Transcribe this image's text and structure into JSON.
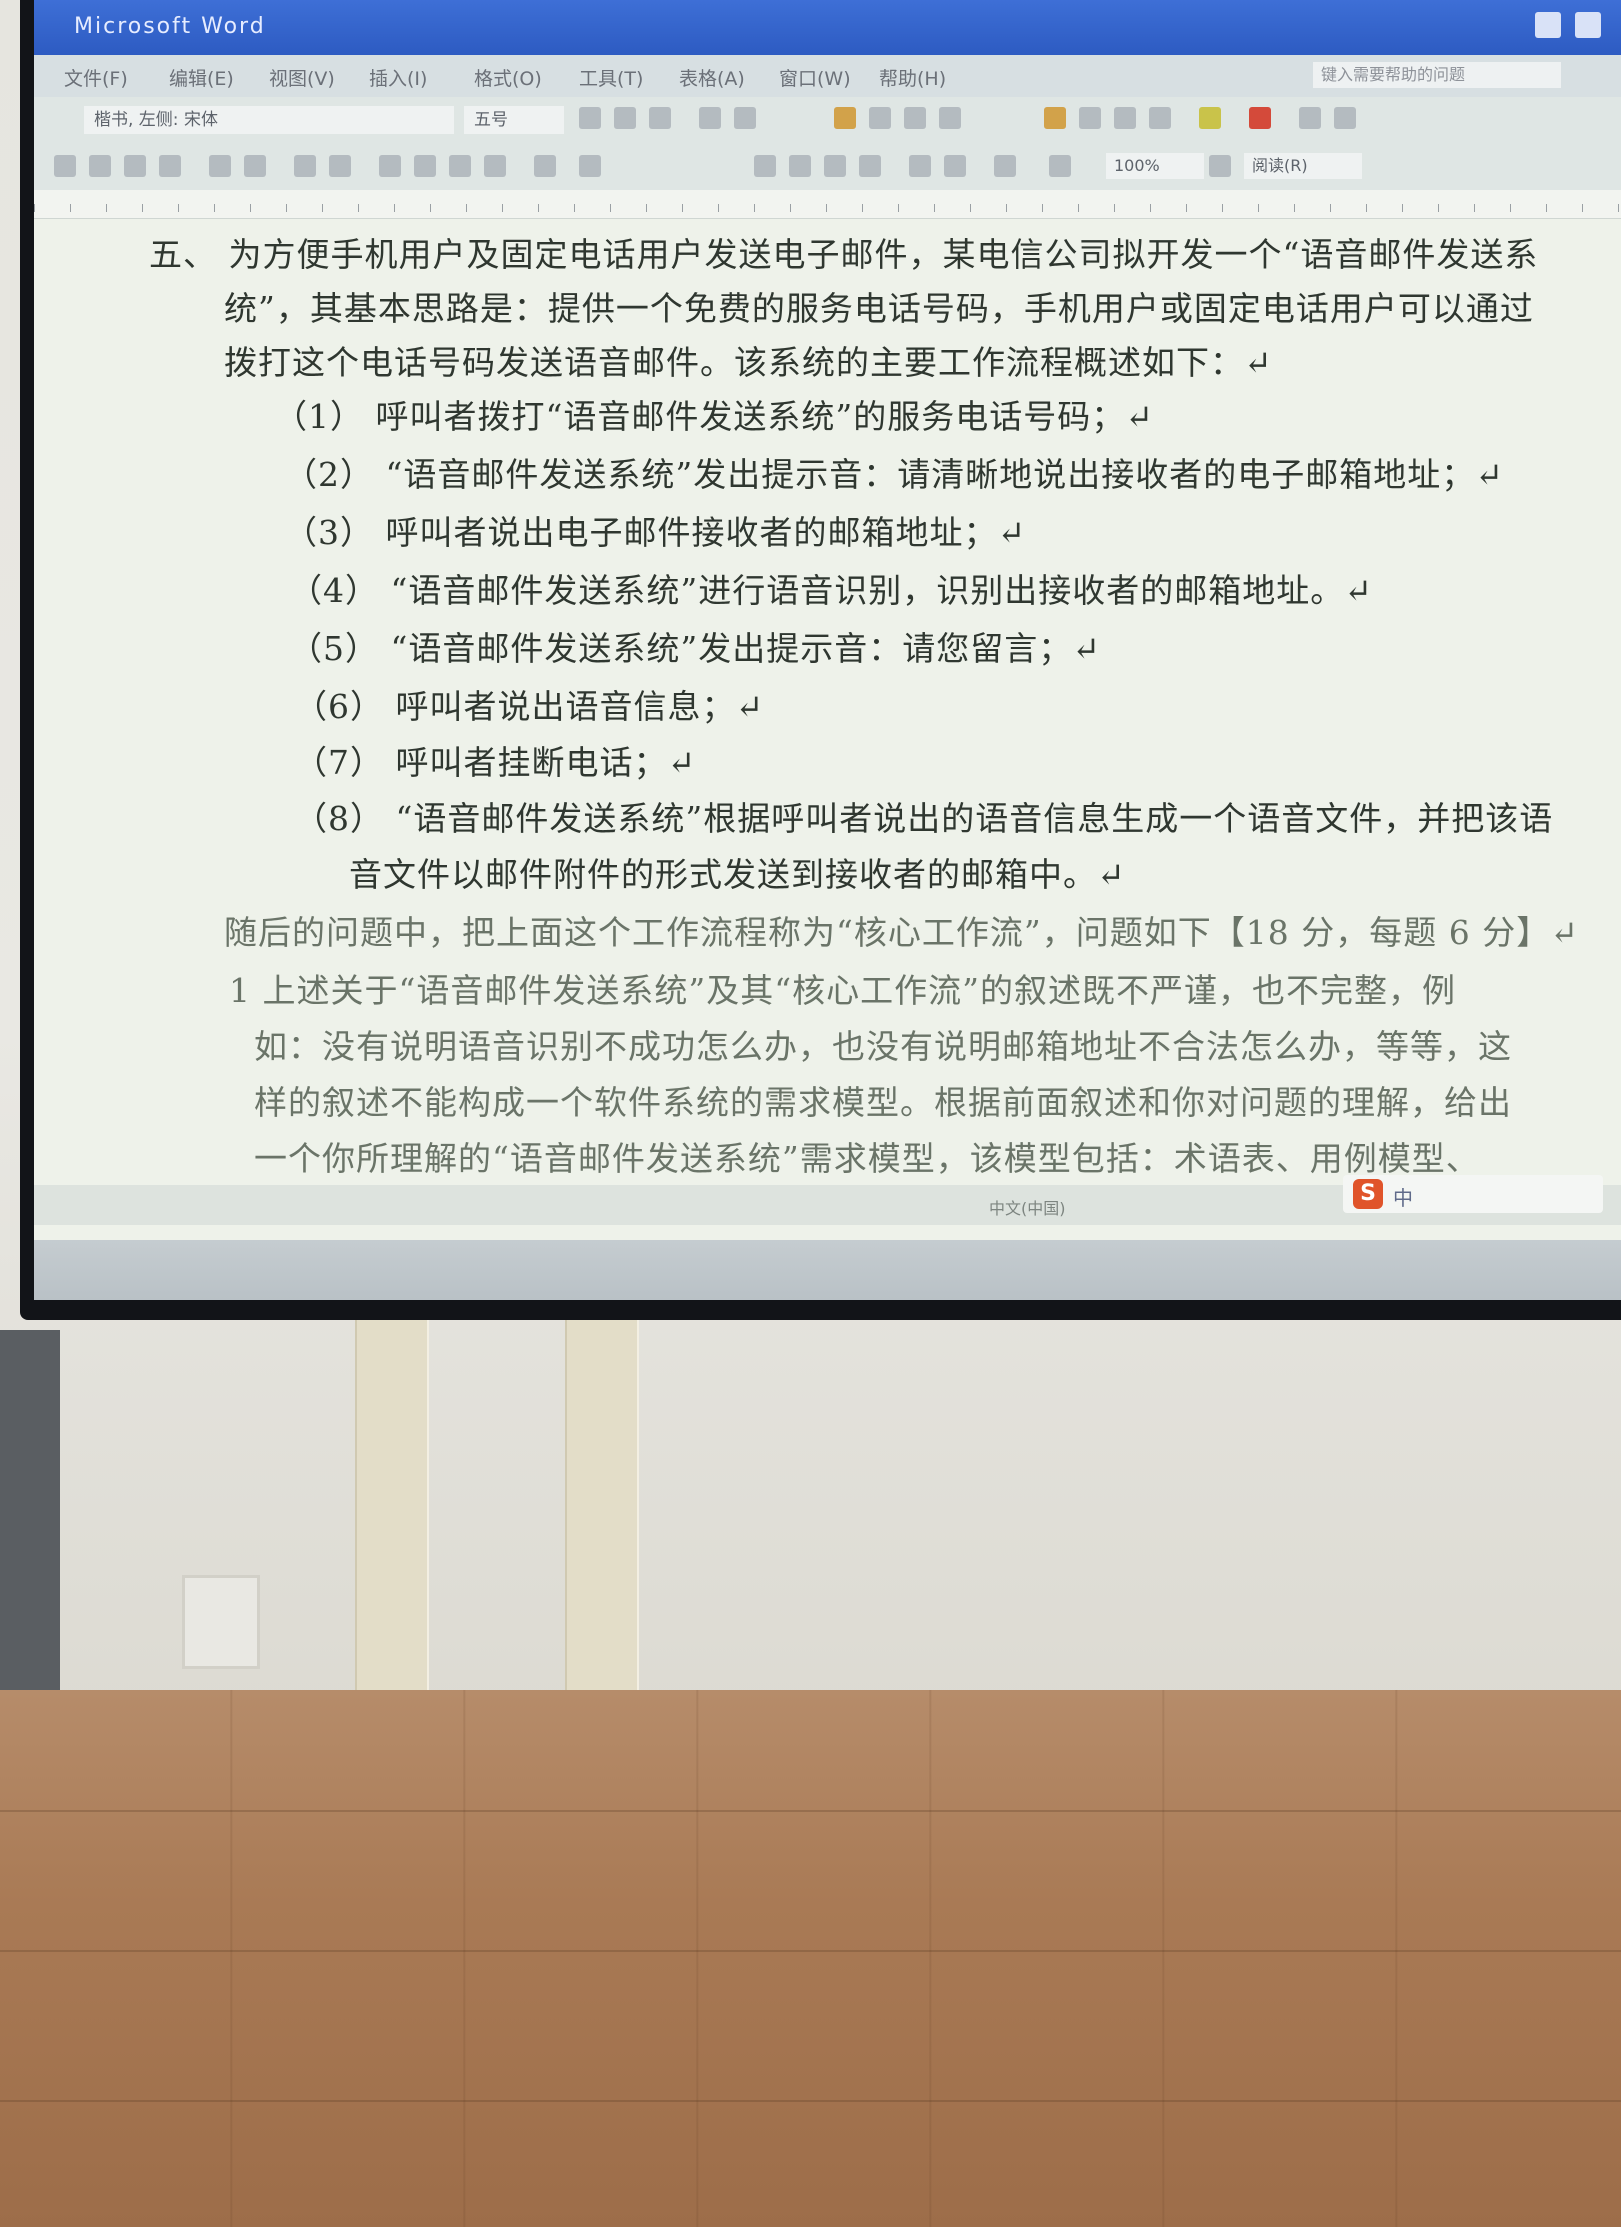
{
  "window": {
    "title": "Microsoft Word"
  },
  "menu": {
    "items": [
      "文件(F)",
      "编辑(E)",
      "视图(V)",
      "插入(I)",
      "格式(O)",
      "工具(T)",
      "表格(A)",
      "窗口(W)",
      "帮助(H)"
    ],
    "help_placeholder": "键入需要帮助的问题"
  },
  "toolbar": {
    "style": "楷书, 左侧: 宋体",
    "font_size": "五号",
    "zoom": "100%",
    "read_label": "阅读(R)"
  },
  "document": {
    "lines": [
      "五、 为方便手机用户及固定电话用户发送电子邮件，某电信公司拟开发一个“语音邮件发送系",
      "统”，其基本思路是：提供一个免费的服务电话号码，手机用户或固定电话用户可以通过",
      "拨打这个电话号码发送语音邮件。该系统的主要工作流程概述如下：↵",
      "（1） 呼叫者拨打“语音邮件发送系统”的服务电话号码；↵",
      "（2） “语音邮件发送系统”发出提示音：请清晰地说出接收者的电子邮箱地址；↵",
      "（3） 呼叫者说出电子邮件接收者的邮箱地址；↵",
      "（4） “语音邮件发送系统”进行语音识别，识别出接收者的邮箱地址。↵",
      "（5） “语音邮件发送系统”发出提示音：请您留言；↵",
      "（6） 呼叫者说出语音信息；↵",
      "（7） 呼叫者挂断电话；↵",
      "（8） “语音邮件发送系统”根据呼叫者说出的语音信息生成一个语音文件，并把该语",
      "音文件以邮件附件的形式发送到接收者的邮箱中。↵",
      "随后的问题中，把上面这个工作流程称为“核心工作流”，问题如下【18 分，每题 6 分】↵",
      "1 上述关于“语音邮件发送系统”及其“核心工作流”的叙述既不严谨，也不完整，例",
      "如：没有说明语音识别不成功怎么办，也没有说明邮箱地址不合法怎么办，等等，这",
      "样的叙述不能构成一个软件系统的需求模型。根据前面叙述和你对问题的理解，给出",
      "一个你所理解的“语音邮件发送系统”需求模型，该模型包括：术语表、用例模型、"
    ]
  },
  "status": {
    "language": "中文(中国)"
  },
  "ime": {
    "label": "中"
  },
  "colors": {
    "title_bar": "#2d5bc2",
    "page_bg": "#eef2ea",
    "ime_logo": "#e0542a"
  }
}
